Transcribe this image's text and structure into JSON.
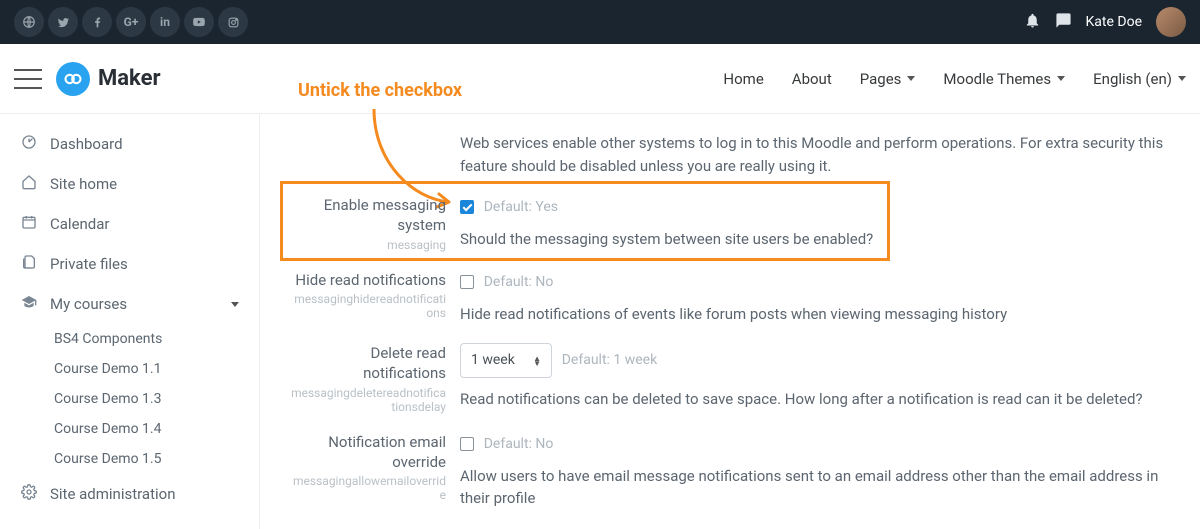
{
  "topbar": {
    "social_icons": [
      "globe",
      "twitter",
      "facebook",
      "google-plus",
      "linkedin",
      "youtube",
      "instagram"
    ],
    "username": "Kate Doe"
  },
  "header": {
    "brand": "Maker",
    "nav": [
      {
        "label": "Home",
        "has_dropdown": false
      },
      {
        "label": "About",
        "has_dropdown": false
      },
      {
        "label": "Pages",
        "has_dropdown": true
      },
      {
        "label": "Moodle Themes",
        "has_dropdown": true
      },
      {
        "label": "English (en)",
        "has_dropdown": true
      }
    ]
  },
  "annotation": {
    "text": "Untick the checkbox"
  },
  "sidebar": {
    "items": [
      {
        "icon": "dashboard",
        "label": "Dashboard"
      },
      {
        "icon": "home",
        "label": "Site home"
      },
      {
        "icon": "calendar",
        "label": "Calendar"
      },
      {
        "icon": "files",
        "label": "Private files"
      },
      {
        "icon": "grad-cap",
        "label": "My courses",
        "has_caret": true
      }
    ],
    "courses": [
      "BS4 Components",
      "Course Demo 1.1",
      "Course Demo 1.3",
      "Course Demo 1.4",
      "Course Demo 1.5"
    ],
    "admin": {
      "icon": "gear",
      "label": "Site administration"
    }
  },
  "settings": {
    "intro_desc": "Web services enable other systems to log in to this Moodle and perform operations. For extra security this feature should be disabled unless you are really using it.",
    "rows": [
      {
        "title": "Enable messaging system",
        "key": "messaging",
        "checked": true,
        "default": "Default: Yes",
        "desc": "Should the messaging system between site users be enabled?"
      },
      {
        "title": "Hide read notifications",
        "key": "messaginghidereadnotifications",
        "checked": false,
        "default": "Default: No",
        "desc": "Hide read notifications of events like forum posts when viewing messaging history"
      },
      {
        "title": "Delete read notifications",
        "key": "messagingdeletereadnotificationsdelay",
        "select_value": "1 week",
        "default": "Default: 1 week",
        "desc": "Read notifications can be deleted to save space. How long after a notification is read can it be deleted?"
      },
      {
        "title": "Notification email override",
        "key": "messagingallowemailoverride",
        "checked": false,
        "default": "Default: No",
        "desc": "Allow users to have email message notifications sent to an email address other than the email address in their profile"
      }
    ]
  }
}
